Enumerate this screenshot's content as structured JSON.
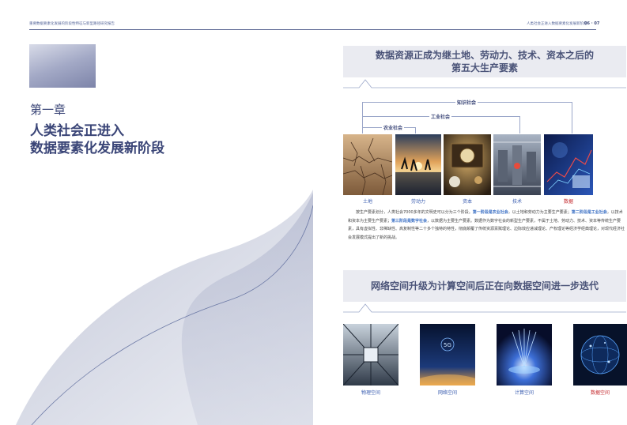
{
  "header": {
    "left_text": "重要数据要素化发展的阶段性特征与新型路径研究报告",
    "right_text": "人类社会正进入数据要素化发展新阶段",
    "page_numbers": "06 · 07"
  },
  "chapter": {
    "label": "第一章",
    "title_line1": "人类社会正进入",
    "title_line2": "数据要素化发展新阶段"
  },
  "section1": {
    "title_line1": "数据资源正成为继土地、劳动力、技术、资本之后的",
    "title_line2": "第五大生产要素",
    "eras": [
      "知识社会",
      "工业社会",
      "农业社会"
    ],
    "factors": [
      {
        "label": "土地",
        "highlight": false
      },
      {
        "label": "劳动力",
        "highlight": false
      },
      {
        "label": "资本",
        "highlight": false
      },
      {
        "label": "技术",
        "highlight": false
      },
      {
        "label": "数据",
        "highlight": true
      }
    ],
    "paragraph": {
      "t1": "按生产要素划分，人类社会7000多年的文明史可以分为三个阶段。",
      "e1": "第一阶段是农业社会",
      "t2": "，以土地和劳动力为主要生产要素；",
      "e2": "第二阶段是工业社会",
      "t3": "，以技术和资本为主要生产要素；",
      "e3": "第三阶段是数字社会",
      "t4": "，以数据为主要生产要素。数据作为数字社会的新型生产要素，不属于土地、劳动力、技术、资本等传统生产要素，具有虚拟性、非稀缺性、高复制性等二十多个独特的特性，彻底颠覆了传统资源禀赋理论、边际效应递减理论、产权理论等经济学经典理论，对现代经济社会发展模式提出了新的挑战。"
    }
  },
  "section2": {
    "title": "网络空间升级为计算空间后正在向数据空间进一步迭代",
    "spaces": [
      {
        "label": "物理空间",
        "highlight": false
      },
      {
        "label": "网络空间",
        "highlight": false
      },
      {
        "label": "计算空间",
        "highlight": false
      },
      {
        "label": "数据空间",
        "highlight": true
      }
    ],
    "badge_5g": "5G"
  },
  "colors": {
    "accent": "#3a4577",
    "link": "#3a6fc4",
    "highlight": "#c3262a",
    "panel": "#eaebf1"
  }
}
